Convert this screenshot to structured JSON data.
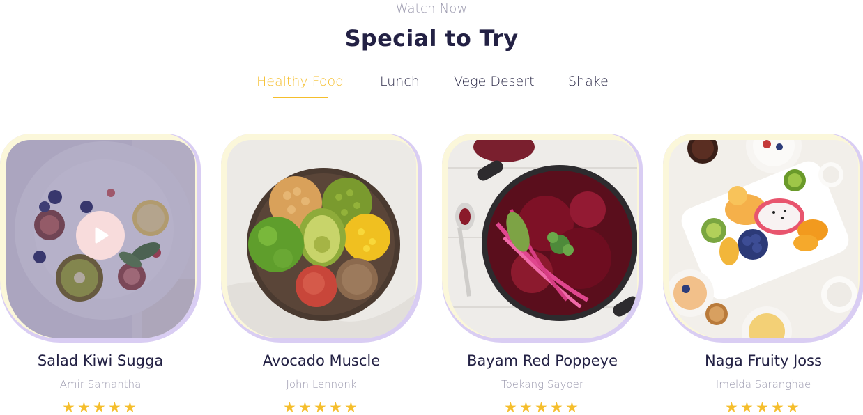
{
  "header": {
    "eyebrow": "Watch Now",
    "title": "Special to Try"
  },
  "tabs": [
    {
      "label": "Healthy Food",
      "active": true
    },
    {
      "label": "Lunch",
      "active": false
    },
    {
      "label": "Vege Desert",
      "active": false
    },
    {
      "label": "Shake",
      "active": false
    }
  ],
  "cards": [
    {
      "name": "Salad Kiwi Sugga",
      "author": "Amir Samantha",
      "rating": 5,
      "has_play": true
    },
    {
      "name": "Avocado Muscle",
      "author": "John Lennonk",
      "rating": 5,
      "has_play": false
    },
    {
      "name": "Bayam Red Poppeye",
      "author": "Toekang Sayoer",
      "rating": 5,
      "has_play": false
    },
    {
      "name": "Naga Fruity Joss",
      "author": "Imelda Saranghae",
      "rating": 5,
      "has_play": false
    }
  ],
  "colors": {
    "accent": "#f5be2c",
    "frame": "#d9cdf3",
    "frame_inner": "#fbf7da",
    "text": "#232144",
    "muted": "#9a98ad"
  }
}
